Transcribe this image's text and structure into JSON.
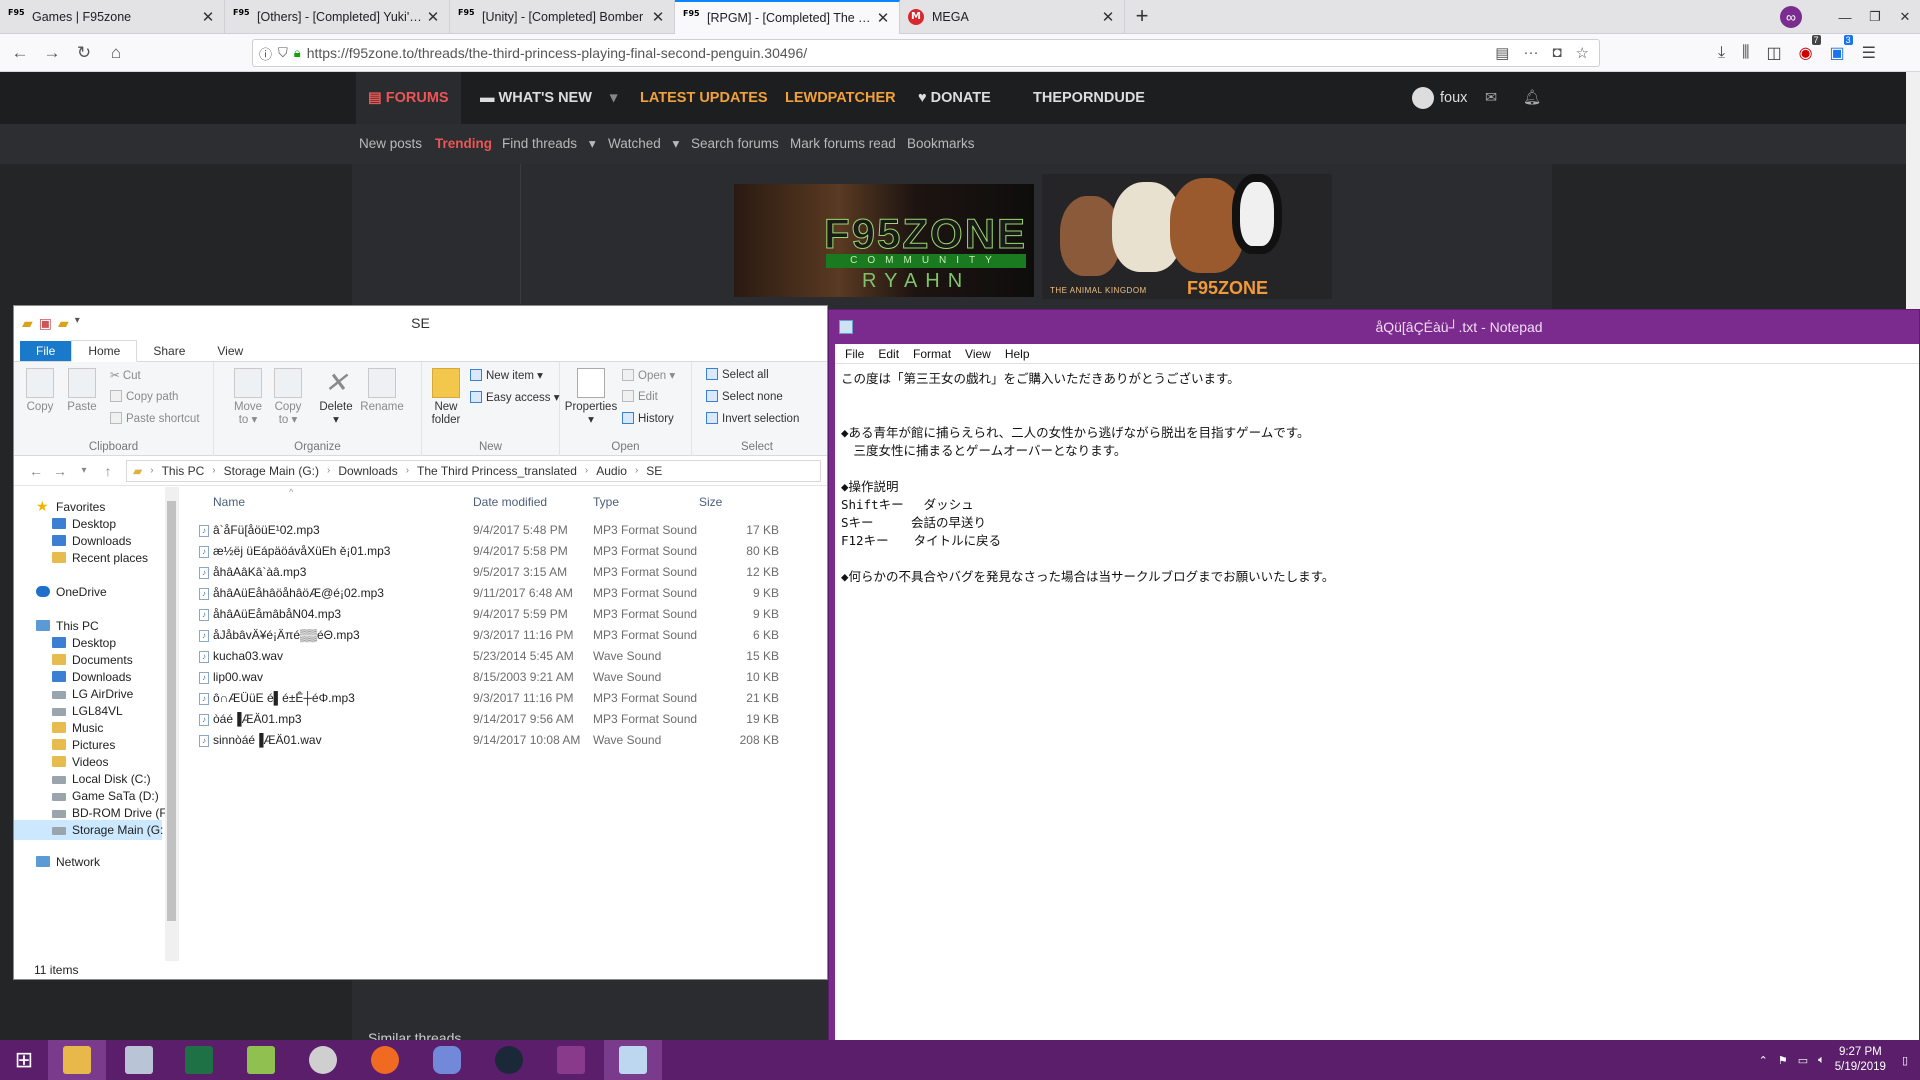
{
  "browser": {
    "tabs": [
      {
        "favicon": "F95",
        "title": "Games | F95zone",
        "active": false
      },
      {
        "favicon": "F95",
        "title": "[Others] - [Completed] Yuki's T",
        "active": false
      },
      {
        "favicon": "F95",
        "title": "[Unity] - [Completed] Bomber",
        "active": false
      },
      {
        "favicon": "F95",
        "title": "[RPGM] - [Completed] The Thi",
        "active": true
      },
      {
        "favicon": "M",
        "title": "MEGA",
        "active": false
      }
    ],
    "url": "https://f95zone.to/threads/the-third-princess-playing-final-second-penguin.30496/",
    "badges": {
      "ublock": "7",
      "other": "3"
    }
  },
  "site": {
    "nav": {
      "forums": "FORUMS",
      "whats_new": "WHAT'S NEW",
      "latest_updates": "LATEST UPDATES",
      "lewdpatcher": "LEWDPATCHER",
      "donate": "DONATE",
      "theporndude": "THEPORNDUDE",
      "user": "foux"
    },
    "subnav": {
      "new_posts": "New posts",
      "trending": "Trending",
      "find_threads": "Find threads",
      "watched": "Watched",
      "search_forums": "Search forums",
      "mark_read": "Mark forums read",
      "bookmarks": "Bookmarks"
    },
    "banner_a": {
      "title": "F95ZONE",
      "sub": "COMMUNITY",
      "name": "RYAHN"
    },
    "banner_b": {
      "caption": "THE ANIMAL KINGDOM",
      "brand": "F95ZONE"
    },
    "similar_threads": "Similar threads"
  },
  "explorer": {
    "title": "SE",
    "ribbon_tabs": [
      "File",
      "Home",
      "Share",
      "View"
    ],
    "clipboard": {
      "copy": "Copy",
      "paste": "Paste",
      "cut": "Cut",
      "copy_path": "Copy path",
      "paste_shortcut": "Paste shortcut",
      "group": "Clipboard"
    },
    "organize": {
      "move_to_1": "Move",
      "move_to_2": "to",
      "copy_to_1": "Copy",
      "copy_to_2": "to",
      "delete": "Delete",
      "rename": "Rename",
      "group": "Organize"
    },
    "new": {
      "new_folder_1": "New",
      "new_folder_2": "folder",
      "new_item": "New item",
      "easy_access": "Easy access",
      "group": "New"
    },
    "open": {
      "properties": "Properties",
      "open": "Open",
      "edit": "Edit",
      "history": "History",
      "group": "Open"
    },
    "select": {
      "select_all": "Select all",
      "select_none": "Select none",
      "invert": "Invert selection",
      "group": "Select"
    },
    "breadcrumbs": [
      "This PC",
      "Storage Main (G:)",
      "Downloads",
      "The Third Princess_translated",
      "Audio",
      "SE"
    ],
    "nav_pane": [
      {
        "label": "Favorites",
        "icon": "star",
        "indent": 0
      },
      {
        "label": "Desktop",
        "icon": "blue",
        "indent": 1
      },
      {
        "label": "Downloads",
        "icon": "blue",
        "indent": 1
      },
      {
        "label": "Recent places",
        "icon": "folder",
        "indent": 1
      },
      {
        "label": "OneDrive",
        "icon": "cloud",
        "indent": 0
      },
      {
        "label": "This PC",
        "icon": "pc",
        "indent": 0
      },
      {
        "label": "Desktop",
        "icon": "blue",
        "indent": 1
      },
      {
        "label": "Documents",
        "icon": "folder",
        "indent": 1
      },
      {
        "label": "Downloads",
        "icon": "blue",
        "indent": 1
      },
      {
        "label": "LG AirDrive",
        "icon": "drive",
        "indent": 1
      },
      {
        "label": "LGL84VL",
        "icon": "drive",
        "indent": 1
      },
      {
        "label": "Music",
        "icon": "folder",
        "indent": 1
      },
      {
        "label": "Pictures",
        "icon": "folder",
        "indent": 1
      },
      {
        "label": "Videos",
        "icon": "folder",
        "indent": 1
      },
      {
        "label": "Local Disk (C:)",
        "icon": "drive",
        "indent": 1
      },
      {
        "label": "Game SaTa (D:)",
        "icon": "drive",
        "indent": 1
      },
      {
        "label": "BD-ROM Drive (F",
        "icon": "drive",
        "indent": 1
      },
      {
        "label": "Storage Main (G:",
        "icon": "drive",
        "indent": 1
      },
      {
        "label": "Network",
        "icon": "pc",
        "indent": 0
      }
    ],
    "columns": {
      "name": "Name",
      "date": "Date modified",
      "type": "Type",
      "size": "Size"
    },
    "files": [
      {
        "name": "â`åFü[åöüE¹02.mp3",
        "date": "9/4/2017 5:48 PM",
        "type": "MP3 Format Sound",
        "size": "17 KB"
      },
      {
        "name": "æ½ëj üEápäöávåXüEh ě¡01.mp3",
        "date": "9/4/2017 5:58 PM",
        "type": "MP3 Format Sound",
        "size": "80 KB"
      },
      {
        "name": "åhâAâKâ`àâ.mp3",
        "date": "9/5/2017 3:15 AM",
        "type": "MP3 Format Sound",
        "size": "12 KB"
      },
      {
        "name": "åhâAüEåhâöåhâöÆ@é¡02.mp3",
        "date": "9/11/2017 6:48 AM",
        "type": "MP3 Format Sound",
        "size": "9 KB"
      },
      {
        "name": "åhâAüEåmâbåN04.mp3",
        "date": "9/4/2017 5:59 PM",
        "type": "MP3 Format Sound",
        "size": "9 KB"
      },
      {
        "name": "åJåbâvÄ¥é¡Äπé▒▒éΘ.mp3",
        "date": "9/3/2017 11:16 PM",
        "type": "MP3 Format Sound",
        "size": "6 KB"
      },
      {
        "name": "kucha03.wav",
        "date": "5/23/2014 5:45 AM",
        "type": "Wave Sound",
        "size": "15 KB"
      },
      {
        "name": "lip00.wav",
        "date": "8/15/2003 9:21 AM",
        "type": "Wave Sound",
        "size": "10 KB"
      },
      {
        "name": "ô∩ÆÜüE é▌é±Ê┼éΦ.mp3",
        "date": "9/3/2017 11:16 PM",
        "type": "MP3 Format Sound",
        "size": "21 KB"
      },
      {
        "name": "òáé▐ÆÄ01.mp3",
        "date": "9/14/2017 9:56 AM",
        "type": "MP3 Format Sound",
        "size": "19 KB"
      },
      {
        "name": "sinnòáé▐ÆÄ01.wav",
        "date": "9/14/2017 10:08 AM",
        "type": "Wave Sound",
        "size": "208 KB"
      }
    ],
    "status": "11 items"
  },
  "notepad": {
    "title": "åQü[âÇÉàü┘.txt - Notepad",
    "menu": [
      "File",
      "Edit",
      "Format",
      "View",
      "Help"
    ],
    "content": "この度は「第三王女の戯れ」をご購入いただきありがとうございます。\n\n\n◆ある青年が館に捕らえられ、二人の女性から逃げながら脱出を目指すゲームです。\n　三度女性に捕まるとゲームオーバーとなります。\n\n◆操作説明\nShiftキー　 ダッシュ\nSキー　　　会話の早送り\nF12キー　　タイトルに戻る\n\n◆何らかの不具合やバグを発見なさった場合は当サークルブログまでお願いいたします。"
  },
  "taskbar": {
    "time": "9:27 PM",
    "date": "5/19/2019"
  }
}
